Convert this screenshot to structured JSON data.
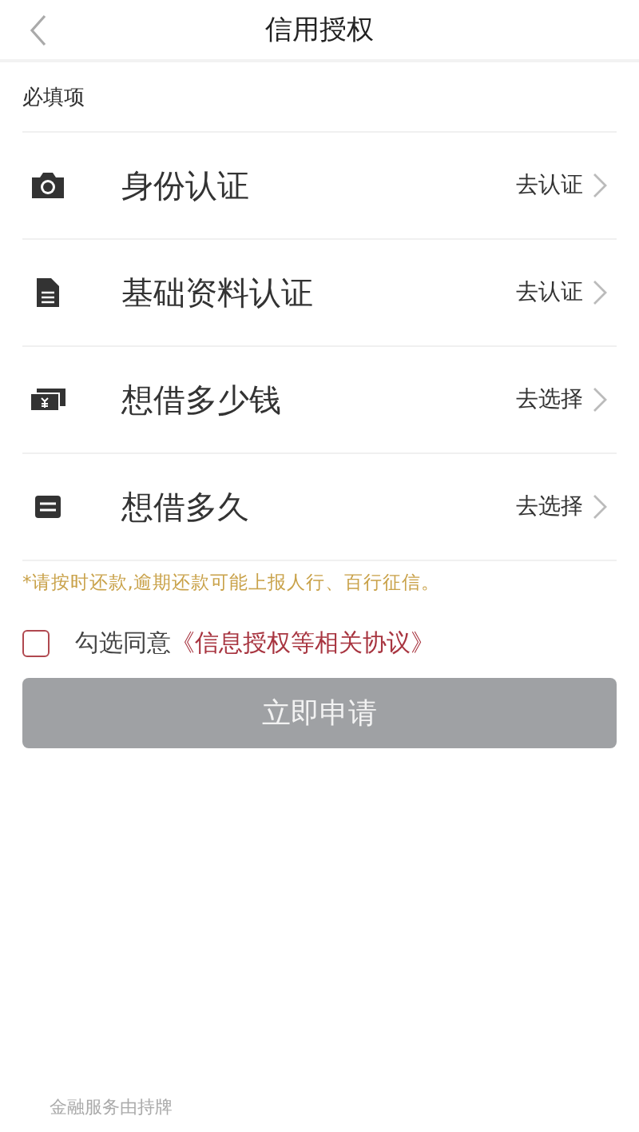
{
  "header": {
    "title": "信用授权"
  },
  "section_title": "必填项",
  "items": [
    {
      "kind": "camera",
      "label": "身份认证",
      "action": "去认证"
    },
    {
      "kind": "document",
      "label": "基础资料认证",
      "action": "去认证"
    },
    {
      "kind": "money",
      "label": "想借多少钱",
      "action": "去选择"
    },
    {
      "kind": "calendar",
      "label": "想借多久",
      "action": "去选择"
    }
  ],
  "notice": "*请按时还款,逾期还款可能上报人行、百行征信。",
  "agreement": {
    "checked": false,
    "text": "勾选同意",
    "link": "《信息授权等相关协议》"
  },
  "submit": {
    "label": "立即申请",
    "disabled": true
  },
  "footer": "金融服务由持牌"
}
